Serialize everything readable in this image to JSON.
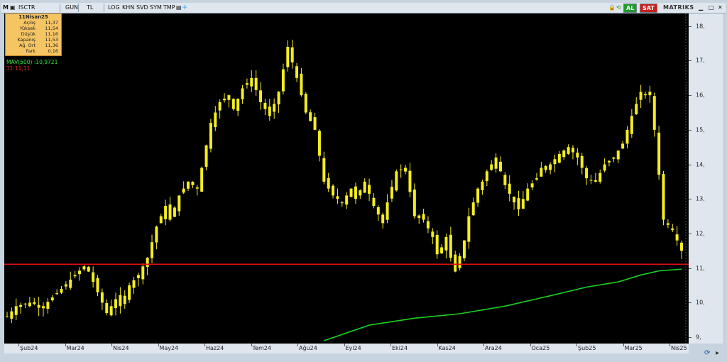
{
  "toolbar": {
    "symbol": "ISCTR",
    "buttons": [
      "GUN",
      "TL",
      "LOG",
      "KHN",
      "SVD",
      "SYM",
      "TMP"
    ],
    "al": "AL",
    "sat": "SAT",
    "brand": "MATRIKS"
  },
  "infobox": {
    "date": "11Nisan25",
    "rows": [
      {
        "label": "Açılış",
        "value": "11,37"
      },
      {
        "label": "Yüksek",
        "value": "11,54"
      },
      {
        "label": "Düşük",
        "value": "11,16"
      },
      {
        "label": "Kapanış",
        "value": "11,53"
      },
      {
        "label": "Ağ. Ort",
        "value": "11,36"
      },
      {
        "label": "Fark",
        "value": "0,16"
      }
    ]
  },
  "legend": {
    "mav": "MAV(500)",
    "mav_value": ":10,9721",
    "t1": "T1:11,11"
  },
  "colors": {
    "candle": "#f5ee1f",
    "mav": "#19d21e",
    "hline": "#e01010"
  },
  "chart_data": {
    "type": "candlestick",
    "ylim": [
      8.9,
      18.2
    ],
    "yticks": [
      "18,",
      "17,",
      "16,",
      "15,",
      "14,",
      "13,",
      "12,",
      "11,",
      "10,",
      "9,"
    ],
    "ytick_values": [
      18,
      17,
      16,
      15,
      14,
      13,
      12,
      11,
      10,
      9
    ],
    "xticks": [
      "Şub24",
      "Mar24",
      "Nis24",
      "May24",
      "Haz24",
      "Tem24",
      "Ağu24",
      "Eyl24",
      "Eki24",
      "Kas24",
      "Ara24",
      "Oca25",
      "Şub25",
      "Mar25",
      "Nis25"
    ],
    "horizontal_line": 11.11,
    "close_path": [
      [
        0,
        9.6
      ],
      [
        2,
        9.9
      ],
      [
        5,
        10.0
      ],
      [
        8,
        9.9
      ],
      [
        12,
        10.4
      ],
      [
        15,
        10.8
      ],
      [
        17,
        11.05
      ],
      [
        18,
        10.9
      ],
      [
        20,
        10.3
      ],
      [
        22,
        9.7
      ],
      [
        24,
        10.1
      ],
      [
        25,
        9.9
      ],
      [
        27,
        10.5
      ],
      [
        29,
        10.8
      ],
      [
        31,
        11.3
      ],
      [
        33,
        12.2
      ],
      [
        35,
        12.8
      ],
      [
        36,
        12.4
      ],
      [
        38,
        13.1
      ],
      [
        40,
        13.5
      ],
      [
        42,
        13.3
      ],
      [
        43,
        13.9
      ],
      [
        45,
        15.2
      ],
      [
        47,
        15.8
      ],
      [
        49,
        16.0
      ],
      [
        50,
        15.6
      ],
      [
        52,
        16.2
      ],
      [
        54,
        16.5
      ],
      [
        56,
        15.8
      ],
      [
        58,
        15.4
      ],
      [
        60,
        16.1
      ],
      [
        62,
        17.4
      ],
      [
        64,
        16.5
      ],
      [
        66,
        15.5
      ],
      [
        68,
        15.0
      ],
      [
        70,
        13.5
      ],
      [
        72,
        13.1
      ],
      [
        74,
        12.9
      ],
      [
        76,
        13.3
      ],
      [
        77,
        13.0
      ],
      [
        79,
        13.5
      ],
      [
        81,
        12.8
      ],
      [
        83,
        12.3
      ],
      [
        84,
        12.9
      ],
      [
        86,
        13.8
      ],
      [
        88,
        13.9
      ],
      [
        90,
        12.5
      ],
      [
        92,
        12.4
      ],
      [
        94,
        11.9
      ],
      [
        95,
        11.4
      ],
      [
        96,
        11.6
      ],
      [
        97,
        11.9
      ],
      [
        98,
        11.3
      ],
      [
        99,
        10.9
      ],
      [
        101,
        11.8
      ],
      [
        102,
        12.5
      ],
      [
        104,
        13.3
      ],
      [
        105,
        13.5
      ],
      [
        106,
        13.8
      ],
      [
        108,
        14.2
      ],
      [
        110,
        13.4
      ],
      [
        112,
        12.9
      ],
      [
        113,
        12.7
      ],
      [
        115,
        13.3
      ],
      [
        117,
        13.6
      ],
      [
        118,
        13.9
      ],
      [
        120,
        14.0
      ],
      [
        122,
        14.3
      ],
      [
        124,
        14.5
      ],
      [
        126,
        14.2
      ],
      [
        128,
        13.6
      ],
      [
        130,
        13.5
      ],
      [
        132,
        14.0
      ],
      [
        134,
        14.2
      ],
      [
        136,
        14.6
      ],
      [
        138,
        15.4
      ],
      [
        140,
        16.1
      ],
      [
        141,
        16.0
      ],
      [
        142,
        16.0
      ],
      [
        143,
        15.0
      ],
      [
        145,
        12.4
      ],
      [
        147,
        12.1
      ],
      [
        148,
        11.8
      ],
      [
        149,
        11.5
      ]
    ],
    "mav_path": [
      [
        70,
        8.9
      ],
      [
        80,
        9.35
      ],
      [
        90,
        9.55
      ],
      [
        100,
        9.68
      ],
      [
        110,
        9.9
      ],
      [
        120,
        10.2
      ],
      [
        128,
        10.45
      ],
      [
        135,
        10.6
      ],
      [
        140,
        10.8
      ],
      [
        144,
        10.92
      ],
      [
        149,
        10.97
      ]
    ]
  }
}
